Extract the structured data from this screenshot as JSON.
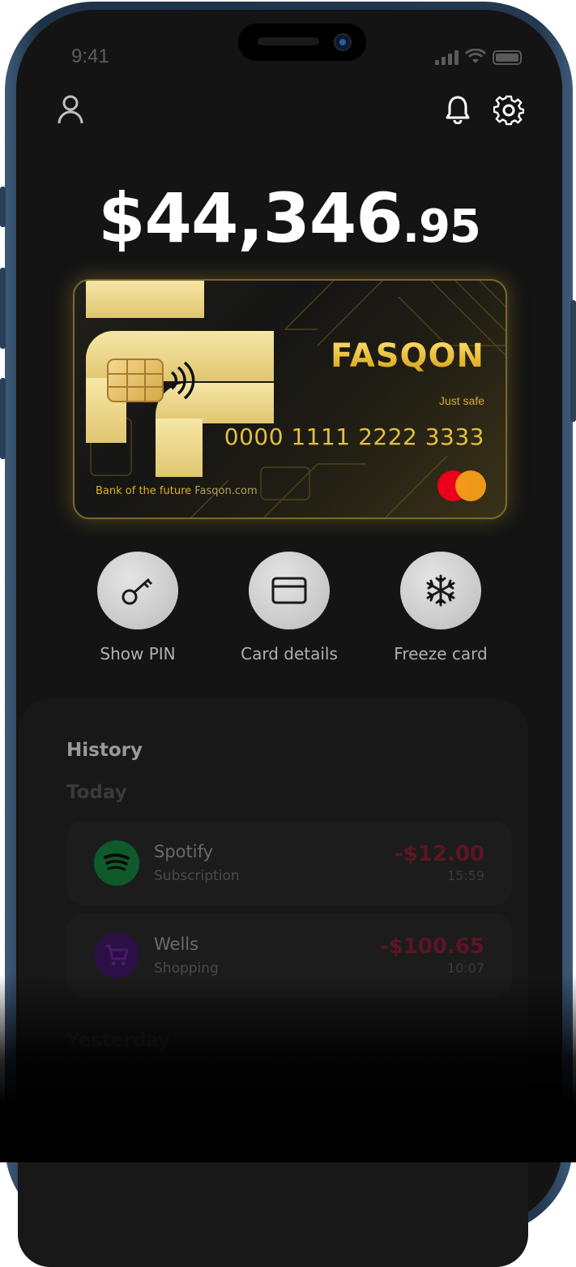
{
  "status_bar": {
    "time": "9:41"
  },
  "header": {
    "profile_icon": "person-icon",
    "bell_icon": "bell-icon",
    "settings_icon": "gear-icon"
  },
  "balance": {
    "main": "$44,346",
    "cents": ".95"
  },
  "card": {
    "brand": "FASQON",
    "tagline": "Just safe",
    "number": "0000 1111 2222 3333",
    "footer_bold": "Bank of the future",
    "footer_url": "Fasqon.com",
    "network": "mastercard",
    "colors": {
      "gold": "#e8b820",
      "mc_red": "#eb001b",
      "mc_orange": "#f79e1b"
    }
  },
  "actions": [
    {
      "label": "Show PIN",
      "icon": "key-icon"
    },
    {
      "label": "Card details",
      "icon": "credit-card-icon"
    },
    {
      "label": "Freeze card",
      "icon": "snowflake-icon"
    }
  ],
  "history": {
    "title": "History",
    "groups": [
      {
        "label": "Today",
        "items": [
          {
            "name": "Spotify",
            "category": "Subscription",
            "amount": "-$12.00",
            "time": "15:59",
            "icon": "spotify-icon",
            "color": "#1db954"
          },
          {
            "name": "Wells",
            "category": "Shopping",
            "amount": "-$100.65",
            "time": "10:07",
            "icon": "cart-icon",
            "color": "#7b2cbf"
          }
        ]
      },
      {
        "label": "Yesterday",
        "items": []
      }
    ]
  }
}
